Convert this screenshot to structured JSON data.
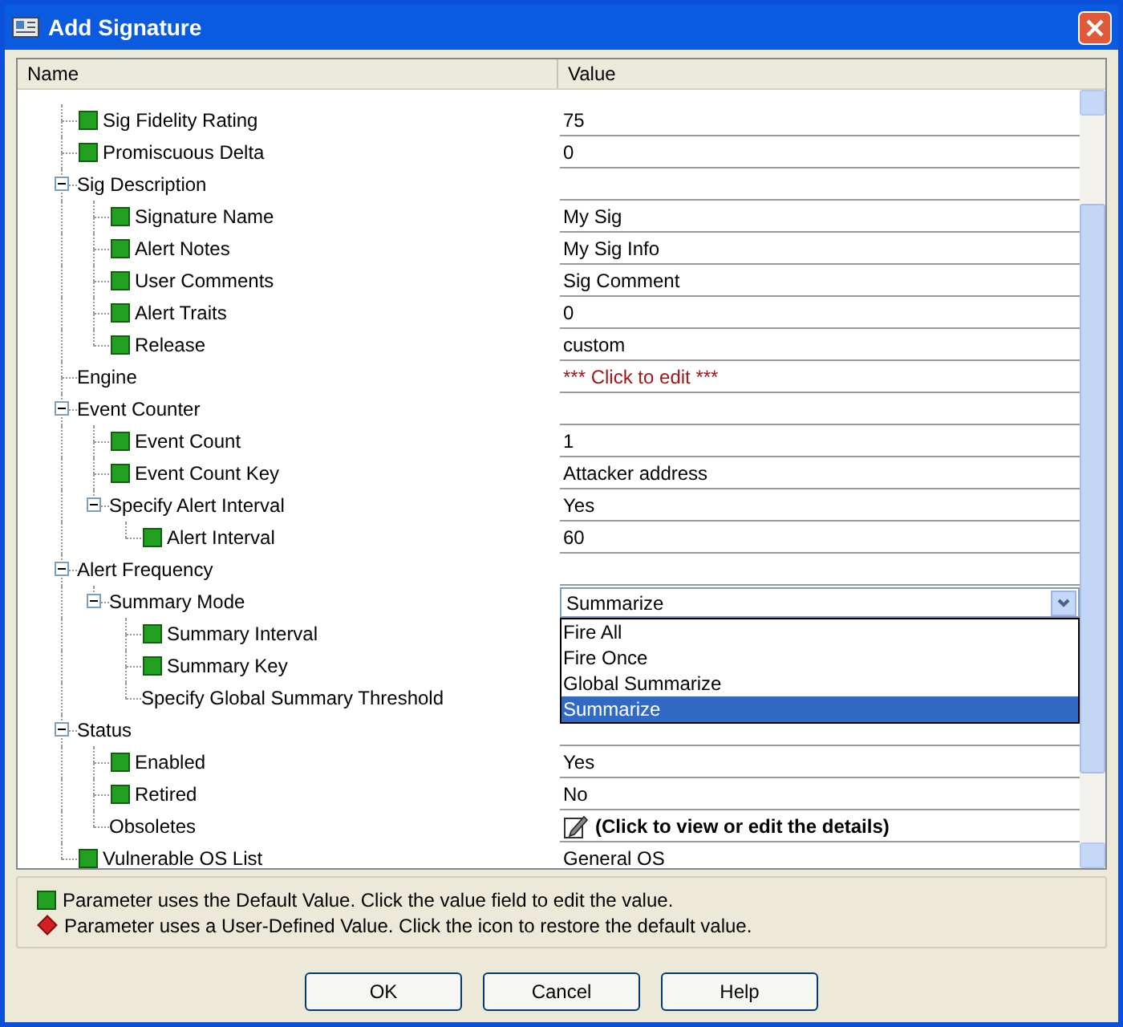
{
  "window": {
    "title": "Add Signature"
  },
  "table": {
    "columns": [
      "Name",
      "Value"
    ],
    "rows": [
      {
        "name": "Sig Fidelity Rating",
        "kind": "default",
        "value": {
          "kind": "text",
          "text": "75"
        }
      },
      {
        "name": "Promiscuous Delta",
        "kind": "default",
        "value": {
          "kind": "text",
          "text": "0"
        }
      },
      {
        "name": "Sig Description",
        "expanded": true,
        "children": [
          {
            "name": "Signature Name",
            "kind": "default",
            "value": {
              "kind": "text",
              "text": "My Sig"
            }
          },
          {
            "name": "Alert Notes",
            "kind": "default",
            "value": {
              "kind": "text",
              "text": "My Sig Info"
            }
          },
          {
            "name": "User Comments",
            "kind": "default",
            "value": {
              "kind": "text",
              "text": "Sig Comment"
            }
          },
          {
            "name": "Alert Traits",
            "kind": "default",
            "value": {
              "kind": "text",
              "text": "0"
            }
          },
          {
            "name": "Release",
            "kind": "default",
            "value": {
              "kind": "text",
              "text": "custom"
            }
          }
        ]
      },
      {
        "name": "Engine",
        "value": {
          "kind": "prompt",
          "text": "*** Click to edit ***"
        }
      },
      {
        "name": "Event Counter",
        "expanded": true,
        "children": [
          {
            "name": "Event Count",
            "kind": "default",
            "value": {
              "kind": "text",
              "text": "1"
            }
          },
          {
            "name": "Event Count Key",
            "kind": "default",
            "value": {
              "kind": "text",
              "text": "Attacker address"
            }
          },
          {
            "name": "Specify Alert Interval",
            "expanded": true,
            "value": {
              "kind": "text",
              "text": "Yes"
            },
            "children": [
              {
                "name": "Alert Interval",
                "kind": "default",
                "value": {
                  "kind": "text",
                  "text": "60"
                }
              }
            ]
          }
        ]
      },
      {
        "name": "Alert Frequency",
        "expanded": true,
        "children": [
          {
            "name": "Summary Mode",
            "expanded": true,
            "value": {
              "kind": "dropdown",
              "text": "Summarize",
              "open": true,
              "options": [
                {
                  "label": "Fire All",
                  "selected": false
                },
                {
                  "label": "Fire Once",
                  "selected": false
                },
                {
                  "label": "Global Summarize",
                  "selected": false
                },
                {
                  "label": "Summarize",
                  "selected": true
                }
              ]
            },
            "children": [
              {
                "name": "Summary Interval",
                "kind": "default"
              },
              {
                "name": "Summary Key",
                "kind": "default"
              },
              {
                "name": "Specify Global Summary Threshold"
              }
            ]
          }
        ]
      },
      {
        "name": "Status",
        "expanded": true,
        "children": [
          {
            "name": "Enabled",
            "kind": "default",
            "value": {
              "kind": "text",
              "text": "Yes"
            }
          },
          {
            "name": "Retired",
            "kind": "default",
            "value": {
              "kind": "text",
              "text": "No"
            }
          },
          {
            "name": "Obsoletes",
            "value": {
              "kind": "details",
              "text": "(Click to view or edit the details)"
            }
          }
        ]
      },
      {
        "name": "Vulnerable OS List",
        "kind": "default",
        "value": {
          "kind": "text",
          "text": "General OS"
        }
      }
    ]
  },
  "legend": [
    {
      "kind": "default",
      "text": "Parameter uses the Default Value.  Click the value field to edit the value."
    },
    {
      "kind": "user",
      "text": "Parameter uses a User-Defined Value.  Click the icon to restore the default value."
    }
  ],
  "buttons": [
    "OK",
    "Cancel",
    "Help"
  ]
}
